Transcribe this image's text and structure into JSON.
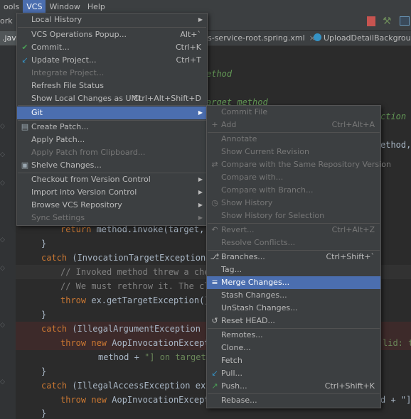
{
  "menubar": {
    "items": [
      "ools",
      "VCS",
      "Window",
      "Help"
    ]
  },
  "toolbar": {
    "left_label": "ork"
  },
  "tabs": {
    "java": ".java",
    "spring": "s-service-root.spring.xml",
    "upload": "UploadDetailBackgroundS",
    "close": "×"
  },
  "code": {
    "l1": "ethod",
    "l2": "arget method",
    "l3": "ction",
    "l4": "ethod, (",
    "return_kw": "return",
    "return_rest": " method.invoke(target, ar",
    "brace1": "}",
    "catch1_kw": "catch",
    "catch1_rest": " (InvocationTargetException ex",
    "cm1": "// Invoked method threw a check",
    "cm2": "// We must rethrow it. The clie",
    "throw1_kw": "throw",
    "throw1_rest": " ex.getTargetException();",
    "brace2": "}",
    "catch2_kw": "catch",
    "catch2_rest": " (IllegalArgumentException ex)",
    "throw2_kw": "throw",
    "throw2_new": " new",
    "throw2_rest": " AopInvocationExceptio",
    "throw2_tail": "lid: tr",
    "method_line_a": "method + ",
    "method_line_str": "\"] on target [",
    "brace3": "}",
    "catch3_kw": "catch",
    "catch3_rest": " (IllegalAccessException ex) {",
    "throw3_kw": "throw",
    "throw3_new": " new",
    "throw3_rest": " AopInvocationExceptio",
    "throw3_tail": "d + \"]",
    "brace4": "}"
  },
  "vcs_menu": {
    "items": [
      {
        "label": "Local History",
        "arrow": "▶"
      },
      {
        "label": "VCS Operations Popup...",
        "shortcut": "Alt+`"
      },
      {
        "label": "Commit...",
        "shortcut": "Ctrl+K",
        "icon": "check-icon"
      },
      {
        "label": "Update Project...",
        "shortcut": "Ctrl+T",
        "icon": "update-arrow-icon"
      },
      {
        "label": "Integrate Project...",
        "disabled": true
      },
      {
        "label": "Refresh File Status"
      },
      {
        "label": "Show Local Changes as UML",
        "shortcut": "Ctrl+Alt+Shift+D"
      },
      {
        "label": "Git",
        "arrow": "▶",
        "selected": true
      },
      {
        "label": "Create Patch...",
        "icon": "patch-icon"
      },
      {
        "label": "Apply Patch..."
      },
      {
        "label": "Apply Patch from Clipboard...",
        "disabled": true
      },
      {
        "label": "Shelve Changes...",
        "icon": "shelve-icon"
      },
      {
        "label": "Checkout from Version Control",
        "arrow": "▶"
      },
      {
        "label": "Import into Version Control",
        "arrow": "▶"
      },
      {
        "label": "Browse VCS Repository",
        "arrow": "▶"
      },
      {
        "label": "Sync Settings",
        "arrow": "▶",
        "disabled": true
      }
    ]
  },
  "git_menu": {
    "items": [
      {
        "label": "Commit File",
        "disabled": true
      },
      {
        "label": "Add",
        "shortcut": "Ctrl+Alt+A",
        "disabled": true,
        "icon": "plus-icon"
      },
      {
        "label": "Annotate",
        "disabled": true
      },
      {
        "label": "Show Current Revision",
        "disabled": true
      },
      {
        "label": "Compare with the Same Repository Version",
        "disabled": true,
        "icon": "compare-icon"
      },
      {
        "label": "Compare with...",
        "disabled": true
      },
      {
        "label": "Compare with Branch...",
        "disabled": true
      },
      {
        "label": "Show History",
        "disabled": true,
        "icon": "clock-icon"
      },
      {
        "label": "Show History for Selection",
        "disabled": true
      },
      {
        "label": "Revert...",
        "shortcut": "Ctrl+Alt+Z",
        "disabled": true,
        "icon": "revert-icon"
      },
      {
        "label": "Resolve Conflicts...",
        "disabled": true
      },
      {
        "label": "Branches...",
        "shortcut": "Ctrl+Shift+`",
        "icon": "branch-icon"
      },
      {
        "label": "Tag..."
      },
      {
        "label": "Merge Changes...",
        "selected": true,
        "icon": "merge-icon"
      },
      {
        "label": "Stash Changes..."
      },
      {
        "label": "UnStash Changes..."
      },
      {
        "label": "Reset HEAD...",
        "icon": "reset-icon"
      },
      {
        "label": "Remotes..."
      },
      {
        "label": "Clone..."
      },
      {
        "label": "Fetch"
      },
      {
        "label": "Pull...",
        "icon": "pull-icon"
      },
      {
        "label": "Push...",
        "shortcut": "Ctrl+Shift+K",
        "icon": "push-icon"
      },
      {
        "label": "Rebase..."
      }
    ]
  },
  "colors": {
    "accent": "#4b6eaf",
    "menu_bg": "#3c3f41",
    "editor_bg": "#2b2b2b",
    "keyword": "#cc7832"
  }
}
